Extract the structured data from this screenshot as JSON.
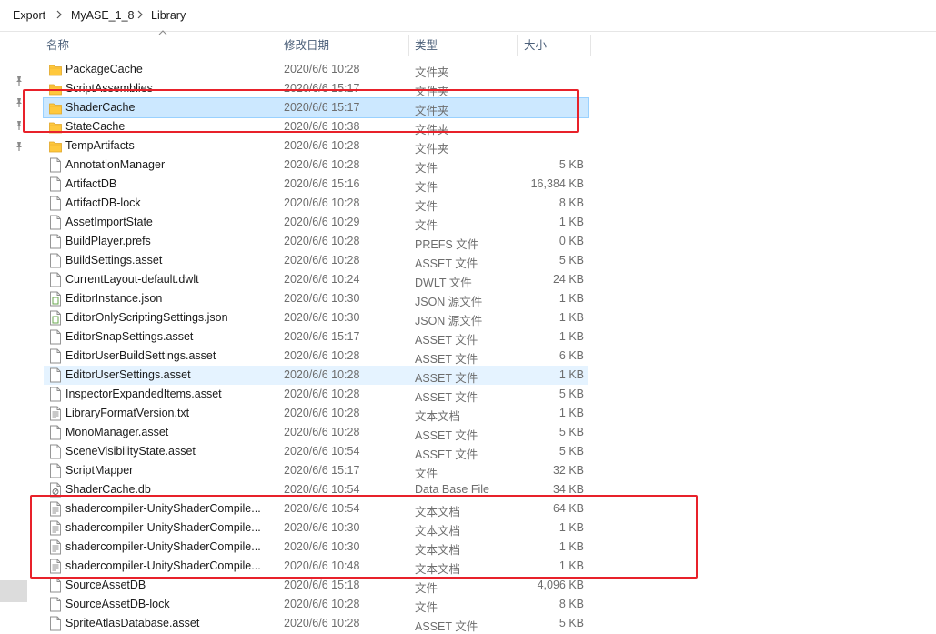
{
  "breadcrumb": [
    "Export",
    "MyASE_1_8",
    "Library"
  ],
  "columns": {
    "name": "名称",
    "date": "修改日期",
    "type": "类型",
    "size": "大小"
  },
  "colors": {
    "accent_selected": "#cce8ff",
    "annotation": "#e8212a",
    "folder": "#ffc83d"
  },
  "files": [
    {
      "name": "PackageCache",
      "date": "2020/6/6 10:28",
      "type": "文件夹",
      "size": "",
      "icon": "folder-icon"
    },
    {
      "name": "ScriptAssemblies",
      "date": "2020/6/6 15:17",
      "type": "文件夹",
      "size": "",
      "icon": "folder-icon"
    },
    {
      "name": "ShaderCache",
      "date": "2020/6/6 15:17",
      "type": "文件夹",
      "size": "",
      "icon": "folder-icon"
    },
    {
      "name": "StateCache",
      "date": "2020/6/6 10:38",
      "type": "文件夹",
      "size": "",
      "icon": "folder-icon"
    },
    {
      "name": "TempArtifacts",
      "date": "2020/6/6 10:28",
      "type": "文件夹",
      "size": "",
      "icon": "folder-icon"
    },
    {
      "name": "AnnotationManager",
      "date": "2020/6/6 10:28",
      "type": "文件",
      "size": "5 KB",
      "icon": "file-icon"
    },
    {
      "name": "ArtifactDB",
      "date": "2020/6/6 15:16",
      "type": "文件",
      "size": "16,384 KB",
      "icon": "file-icon"
    },
    {
      "name": "ArtifactDB-lock",
      "date": "2020/6/6 10:28",
      "type": "文件",
      "size": "8 KB",
      "icon": "file-icon"
    },
    {
      "name": "AssetImportState",
      "date": "2020/6/6 10:29",
      "type": "文件",
      "size": "1 KB",
      "icon": "file-icon"
    },
    {
      "name": "BuildPlayer.prefs",
      "date": "2020/6/6 10:28",
      "type": "PREFS 文件",
      "size": "0 KB",
      "icon": "file-icon"
    },
    {
      "name": "BuildSettings.asset",
      "date": "2020/6/6 10:28",
      "type": "ASSET 文件",
      "size": "5 KB",
      "icon": "file-icon"
    },
    {
      "name": "CurrentLayout-default.dwlt",
      "date": "2020/6/6 10:24",
      "type": "DWLT 文件",
      "size": "24 KB",
      "icon": "file-icon"
    },
    {
      "name": "EditorInstance.json",
      "date": "2020/6/6 10:30",
      "type": "JSON 源文件",
      "size": "1 KB",
      "icon": "json-file-icon"
    },
    {
      "name": "EditorOnlyScriptingSettings.json",
      "date": "2020/6/6 10:30",
      "type": "JSON 源文件",
      "size": "1 KB",
      "icon": "json-file-icon"
    },
    {
      "name": "EditorSnapSettings.asset",
      "date": "2020/6/6 15:17",
      "type": "ASSET 文件",
      "size": "1 KB",
      "icon": "file-icon"
    },
    {
      "name": "EditorUserBuildSettings.asset",
      "date": "2020/6/6 10:28",
      "type": "ASSET 文件",
      "size": "6 KB",
      "icon": "file-icon"
    },
    {
      "name": "EditorUserSettings.asset",
      "date": "2020/6/6 10:28",
      "type": "ASSET 文件",
      "size": "1 KB",
      "icon": "file-icon"
    },
    {
      "name": "InspectorExpandedItems.asset",
      "date": "2020/6/6 10:28",
      "type": "ASSET 文件",
      "size": "5 KB",
      "icon": "file-icon"
    },
    {
      "name": "LibraryFormatVersion.txt",
      "date": "2020/6/6 10:28",
      "type": "文本文档",
      "size": "1 KB",
      "icon": "text-file-icon"
    },
    {
      "name": "MonoManager.asset",
      "date": "2020/6/6 10:28",
      "type": "ASSET 文件",
      "size": "5 KB",
      "icon": "file-icon"
    },
    {
      "name": "SceneVisibilityState.asset",
      "date": "2020/6/6 10:54",
      "type": "ASSET 文件",
      "size": "5 KB",
      "icon": "file-icon"
    },
    {
      "name": "ScriptMapper",
      "date": "2020/6/6 15:17",
      "type": "文件",
      "size": "32 KB",
      "icon": "file-icon"
    },
    {
      "name": "ShaderCache.db",
      "date": "2020/6/6 10:54",
      "type": "Data Base File",
      "size": "34 KB",
      "icon": "db-file-icon"
    },
    {
      "name": "shadercompiler-UnityShaderCompile...",
      "date": "2020/6/6 10:54",
      "type": "文本文档",
      "size": "64 KB",
      "icon": "text-file-icon"
    },
    {
      "name": "shadercompiler-UnityShaderCompile...",
      "date": "2020/6/6 10:30",
      "type": "文本文档",
      "size": "1 KB",
      "icon": "text-file-icon"
    },
    {
      "name": "shadercompiler-UnityShaderCompile...",
      "date": "2020/6/6 10:30",
      "type": "文本文档",
      "size": "1 KB",
      "icon": "text-file-icon"
    },
    {
      "name": "shadercompiler-UnityShaderCompile...",
      "date": "2020/6/6 10:48",
      "type": "文本文档",
      "size": "1 KB",
      "icon": "text-file-icon"
    },
    {
      "name": "SourceAssetDB",
      "date": "2020/6/6 15:18",
      "type": "文件",
      "size": "4,096 KB",
      "icon": "file-icon"
    },
    {
      "name": "SourceAssetDB-lock",
      "date": "2020/6/6 10:28",
      "type": "文件",
      "size": "8 KB",
      "icon": "file-icon"
    },
    {
      "name": "SpriteAtlasDatabase.asset",
      "date": "2020/6/6 10:28",
      "type": "ASSET 文件",
      "size": "5 KB",
      "icon": "file-icon"
    }
  ]
}
